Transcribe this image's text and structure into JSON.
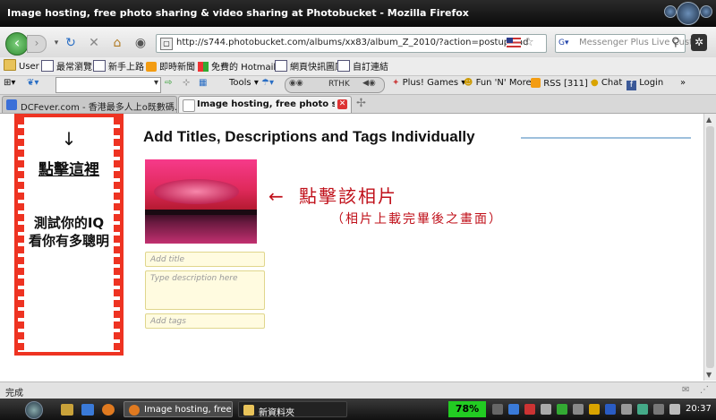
{
  "window": {
    "title": "Image hosting, free photo sharing & video sharing at Photobucket - Mozilla Firefox"
  },
  "navbar": {
    "url": "http://s744.photobucket.com/albums/xx83/album_Z_2010/?action=postupload",
    "search_placeholder": "Messenger Plus Live Custo"
  },
  "bookmarks": [
    {
      "label": "User",
      "icon": "folder-icon"
    },
    {
      "label": "最常瀏覽",
      "icon": "page-icon"
    },
    {
      "label": "新手上路",
      "icon": "page-icon"
    },
    {
      "label": "即時新聞",
      "icon": "rss-icon"
    },
    {
      "label": "免費的 Hotmail",
      "icon": "windows-icon"
    },
    {
      "label": "網頁快訊圖庫",
      "icon": "page-icon"
    },
    {
      "label": "自訂連結",
      "icon": "page-icon"
    }
  ],
  "toolbar": {
    "tools_label": "Tools",
    "player_label": "RTHK",
    "plus_games": "Plus! Games",
    "fun_n_more": "Fun 'N' More",
    "rss_label": "RSS [311]",
    "chat_label": "Chat",
    "login_label": "Login"
  },
  "tabs": [
    {
      "label": "DCFever.com - 香港最多人上o既數碼...",
      "active": false
    },
    {
      "label": "Image hosting, free photo sharin...",
      "active": true
    }
  ],
  "ad": {
    "arrow": "↓",
    "link_text": "點擊這裡",
    "iq_line1": "測試你的IQ",
    "iq_line2": "看你有多聰明"
  },
  "page": {
    "heading": "Add Titles, Descriptions and Tags Individually",
    "title_placeholder": "Add title",
    "description_placeholder": "Type description here",
    "tags_placeholder": "Add tags"
  },
  "annotation": {
    "arrow": "←",
    "main": "點擊該相片",
    "sub": "（相片上載完畢後之畫面）"
  },
  "statusbar": {
    "text": "完成"
  },
  "taskbar": {
    "tasks": [
      {
        "label": "Image hosting, free ph..."
      },
      {
        "label": "新資料夾"
      }
    ],
    "battery": "78%",
    "clock": "20:37"
  },
  "colors": {
    "accent_red": "#e32",
    "annotation_red": "#c0101a",
    "field_bg": "#fffbe0"
  }
}
